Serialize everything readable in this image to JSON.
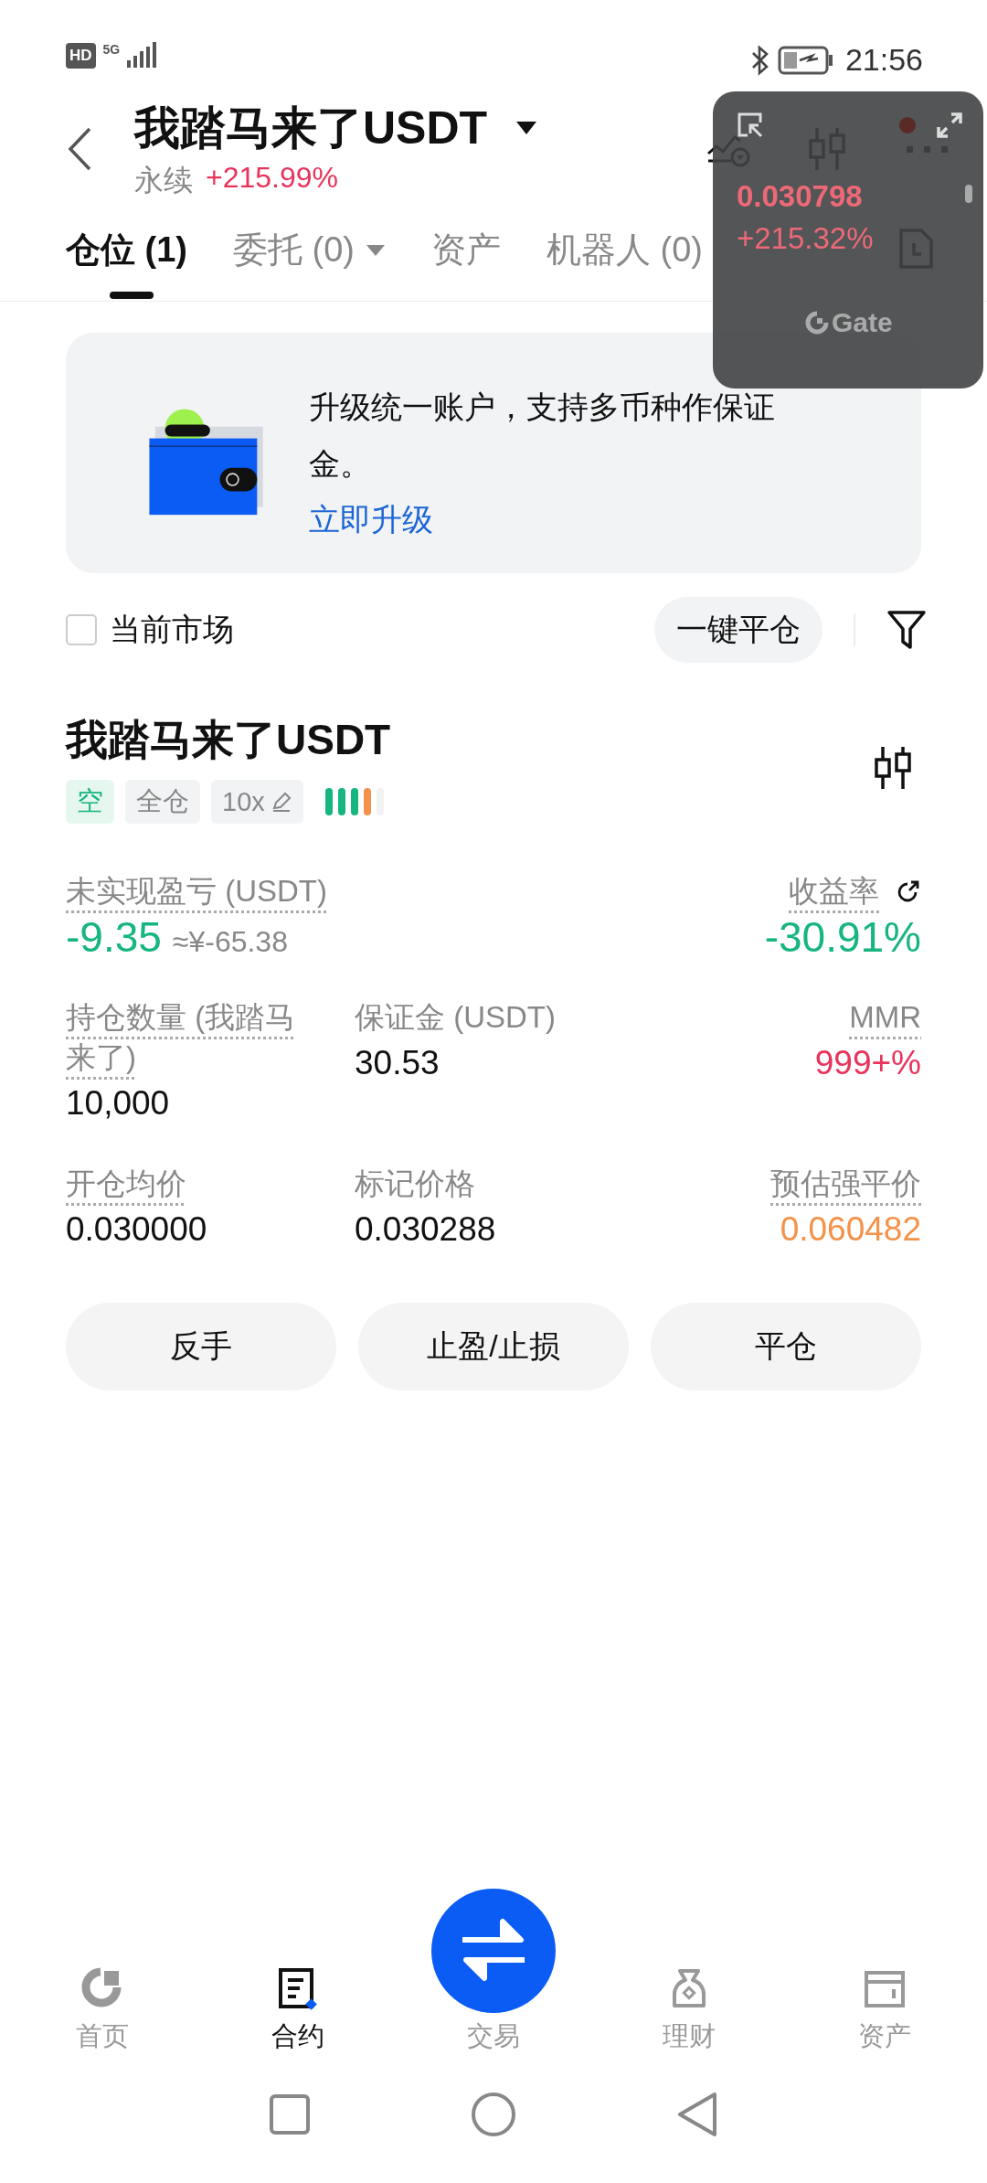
{
  "status_bar": {
    "hd": "HD",
    "network": "5G",
    "time": "21:56"
  },
  "header": {
    "title": "我踏马来了USDT",
    "subtitle": "永续",
    "change": "+215.99%"
  },
  "tabs": [
    {
      "label": "仓位 (1)",
      "selected": true,
      "dropdown": false
    },
    {
      "label": "委托 (0)",
      "selected": false,
      "dropdown": true
    },
    {
      "label": "资产",
      "selected": false,
      "dropdown": false
    },
    {
      "label": "机器人 (0)",
      "selected": false,
      "dropdown": false
    }
  ],
  "floating_widget": {
    "price": "0.030798",
    "change": "+215.32%",
    "logo": "Gate"
  },
  "banner": {
    "text": "升级统一账户，支持多币种作保证金。",
    "link": "立即升级"
  },
  "filter": {
    "checkbox": {
      "label": "当前市场",
      "checked": false
    },
    "close_all": "一键平仓"
  },
  "position": {
    "title": "我踏马来了USDT",
    "tags": [
      {
        "label": "空",
        "kind": "side"
      },
      {
        "label": "全仓",
        "kind": "plain"
      },
      {
        "label": "10x",
        "kind": "editable"
      }
    ],
    "risk": {
      "level": 0.8
    },
    "rows": [
      {
        "left": {
          "label": "未实现盈亏 (USDT)",
          "dotted": true,
          "value": "-9.35",
          "color": "#17b57f",
          "note": "≈¥-65.38"
        },
        "right": {
          "label": "收益率",
          "dotted": true,
          "share": true,
          "value": "-30.91%",
          "color": "#17b57f"
        }
      },
      {
        "left": {
          "label": "持仓数量 (我踏马来了)",
          "dotted": true,
          "value": "10,000",
          "color": "#111111"
        },
        "middle": {
          "label": "保证金 (USDT)",
          "dotted": false,
          "value": "30.53",
          "color": "#111111"
        },
        "right": {
          "label": "MMR",
          "dotted": true,
          "value": "999+%",
          "color": "#e8335c"
        }
      },
      {
        "left": {
          "label": "开仓均价",
          "dotted": true,
          "value": "0.030000",
          "color": "#111111"
        },
        "middle": {
          "label": "标记价格",
          "dotted": false,
          "value": "0.030288",
          "color": "#111111"
        },
        "right": {
          "label": "预估强平价",
          "dotted": true,
          "value": "0.060482",
          "color": "#f49249"
        }
      }
    ],
    "actions": [
      "反手",
      "止盈/止损",
      "平仓"
    ]
  },
  "bottom_nav": [
    {
      "label": "首页",
      "selected": false,
      "kind": "tab"
    },
    {
      "label": "合约",
      "selected": true,
      "kind": "tab"
    },
    {
      "label": "交易",
      "selected": false,
      "kind": "fab"
    },
    {
      "label": "理财",
      "selected": false,
      "kind": "tab"
    },
    {
      "label": "资产",
      "selected": false,
      "kind": "tab"
    }
  ]
}
